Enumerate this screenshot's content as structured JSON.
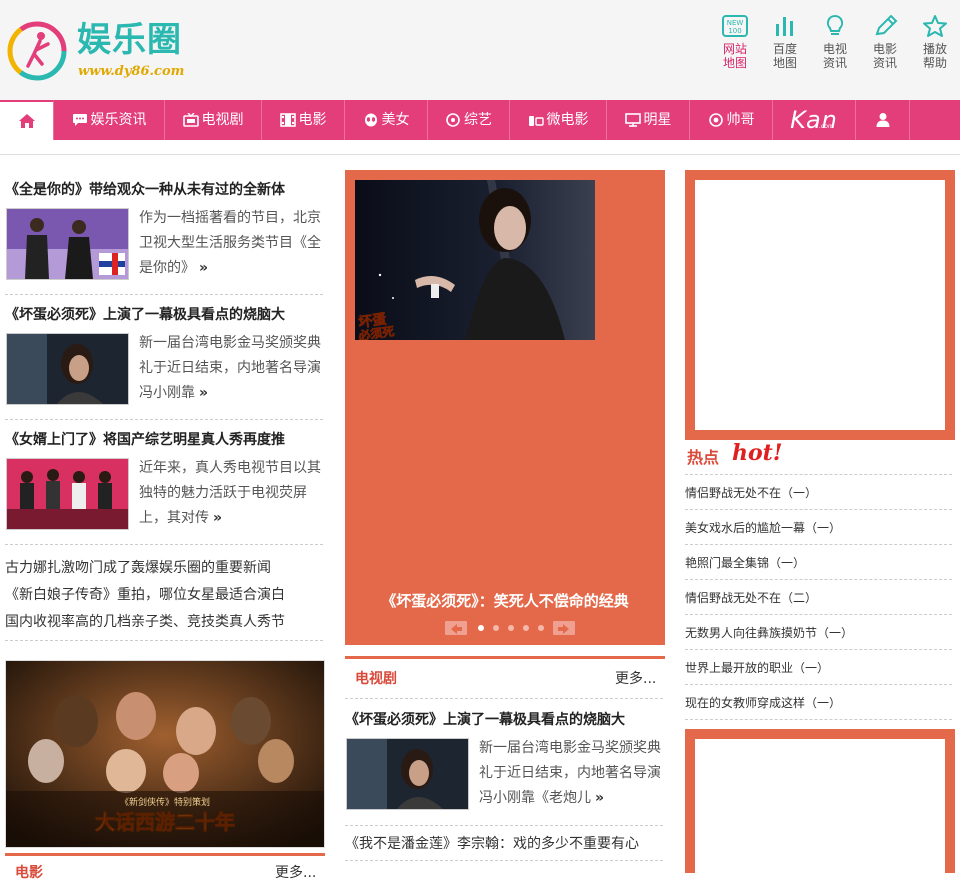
{
  "header": {
    "logo_text": "娱乐圈",
    "logo_url": "www.dy86.com",
    "quick_links": [
      {
        "line1": "网站",
        "line2": "地图",
        "icon": "new-badge-icon"
      },
      {
        "line1": "百度",
        "line2": "地图",
        "icon": "bar-chart-icon"
      },
      {
        "line1": "电视",
        "line2": "资讯",
        "icon": "lightbulb-icon"
      },
      {
        "line1": "电影",
        "line2": "资讯",
        "icon": "pencil-icon"
      },
      {
        "line1": "播放",
        "line2": "帮助",
        "icon": "star-icon"
      }
    ],
    "new_badge_text": "NEW",
    "new_badge_num": "100"
  },
  "nav": {
    "items": [
      "娱乐资讯",
      "电视剧",
      "电影",
      "美女",
      "综艺",
      "微电影",
      "明星",
      "帅哥"
    ],
    "kan_text": "Kan",
    "kan_sub": ".com"
  },
  "left_news": [
    {
      "title": "《全是你的》带给观众一种从未有过的全新体",
      "desc": "作为一档摇著看的节目，北京卫视大型生活服务类节目《全是你的》",
      "more": "»"
    },
    {
      "title": "《坏蛋必须死》上演了一幕极具看点的烧脑大",
      "desc": "新一届台湾电影金马奖颁奖典礼于近日结束，内地著名导演冯小刚靠",
      "more": "»"
    },
    {
      "title": "《女婿上门了》将国产综艺明星真人秀再度推",
      "desc": "近年来，真人秀电视节目以其独特的魅力活跃于电视荧屏上，其对传",
      "more": "»"
    }
  ],
  "left_textlist": [
    "古力娜扎激吻门成了轰爆娱乐圈的重要新闻",
    "《新白娘子传奇》重拍，哪位女星最适合演白",
    "国内收视率高的几档亲子类、竞技类真人秀节"
  ],
  "poster": {
    "small_text": "《新剑侠传》特别策划",
    "title": "大话西游二十年"
  },
  "left_section": {
    "label": "电影",
    "more": "更多..."
  },
  "slider": {
    "caption": "《坏蛋必须死》：笑死人不偿命的经典",
    "badge_line1": "坏蛋",
    "badge_line2": "必须死",
    "active_dot": 0,
    "dot_count": 5
  },
  "tv": {
    "label": "电视剧",
    "more": "更多...",
    "news_title": "《坏蛋必须死》上演了一幕极具看点的烧脑大",
    "news_desc": "新一届台湾电影金马奖颁奖典礼于近日结束，内地著名导演冯小刚靠《老炮儿",
    "news_more": "»",
    "extra_line": "《我不是潘金莲》李宗翰：戏的多少不重要有心"
  },
  "hot": {
    "title": "热点",
    "script": "hot!",
    "items": [
      "情侣野战无处不在（一）",
      "美女戏水后的尴尬一幕（一）",
      "艳照门最全集锦（一）",
      "情侣野战无处不在（二）",
      "无数男人向往彝族摸奶节（一）",
      "世界上最开放的职业（一）",
      "现在的女教师穿成这样（一）"
    ]
  },
  "colors": {
    "brand_pink": "#e33d7a",
    "accent_orange": "#e4694a",
    "logo_teal": "#2ab8b0"
  }
}
